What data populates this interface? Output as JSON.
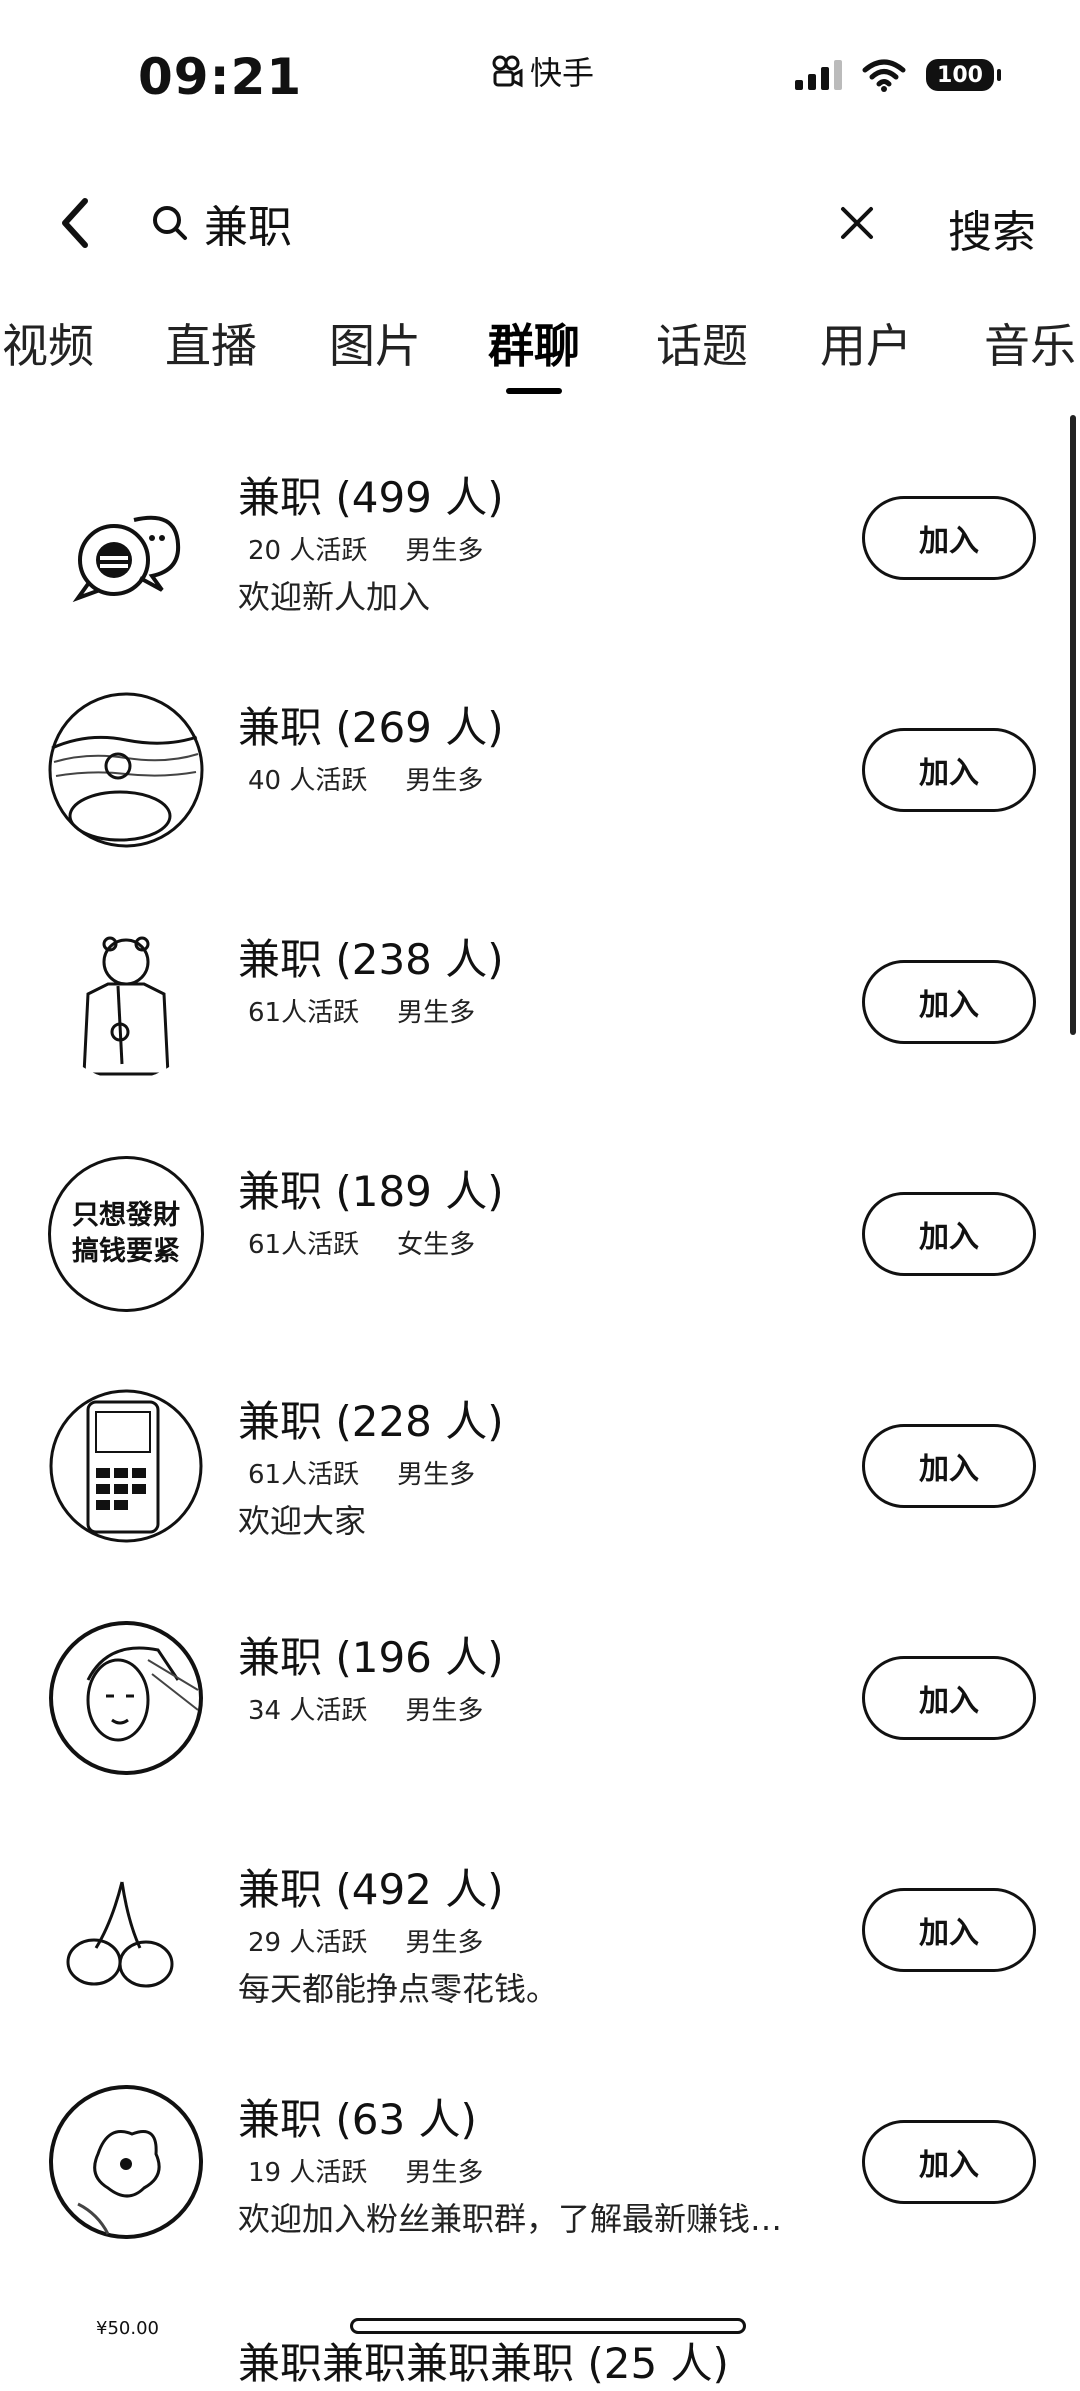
{
  "status_bar": {
    "time": "09:21",
    "app_name": "快手",
    "battery": "100"
  },
  "search": {
    "query": "兼职",
    "search_button": "搜索"
  },
  "tabs": [
    "视频",
    "直播",
    "图片",
    "群聊",
    "话题",
    "用户",
    "音乐"
  ],
  "active_tab": "群聊",
  "groups": [
    {
      "title": "兼职 (499 人)",
      "active": "20 人活跃",
      "gender": "男生多",
      "desc": "欢迎新人加入",
      "join": "加入",
      "avatar": "chat-bubble"
    },
    {
      "title": "兼职 (269 人)",
      "active": "40 人活跃",
      "gender": "男生多",
      "desc": "",
      "join": "加入",
      "avatar": "photo-sea"
    },
    {
      "title": "兼职 (238 人)",
      "active": "61人活跃",
      "gender": "男生多",
      "desc": "",
      "join": "加入",
      "avatar": "photo-bear"
    },
    {
      "title": "兼职 (189 人)",
      "active": "61人活跃",
      "gender": "女生多",
      "desc": "",
      "join": "加入",
      "avatar": "text-sign",
      "avatar_text_1": "只想發財",
      "avatar_text_2": "搞钱要紧"
    },
    {
      "title": "兼职 (228 人)",
      "active": "61人活跃",
      "gender": "男生多",
      "desc": "欢迎大家",
      "join": "加入",
      "avatar": "photo-phone"
    },
    {
      "title": "兼职 (196 人)",
      "active": "34 人活跃",
      "gender": "男生多",
      "desc": "",
      "join": "加入",
      "avatar": "photo-face"
    },
    {
      "title": "兼职 (492 人)",
      "active": "29 人活跃",
      "gender": "男生多",
      "desc": "每天都能挣点零花钱。",
      "join": "加入",
      "avatar": "photo-cherry"
    },
    {
      "title": "兼职 (63 人)",
      "active": "19 人活跃",
      "gender": "男生多",
      "desc": "欢迎加入粉丝兼职群，了解最新赚钱…",
      "join": "加入",
      "avatar": "photo-flower"
    }
  ],
  "partial_row": {
    "price": "¥50.00",
    "title": "兼职兼职兼职兼职 (25 人)"
  }
}
